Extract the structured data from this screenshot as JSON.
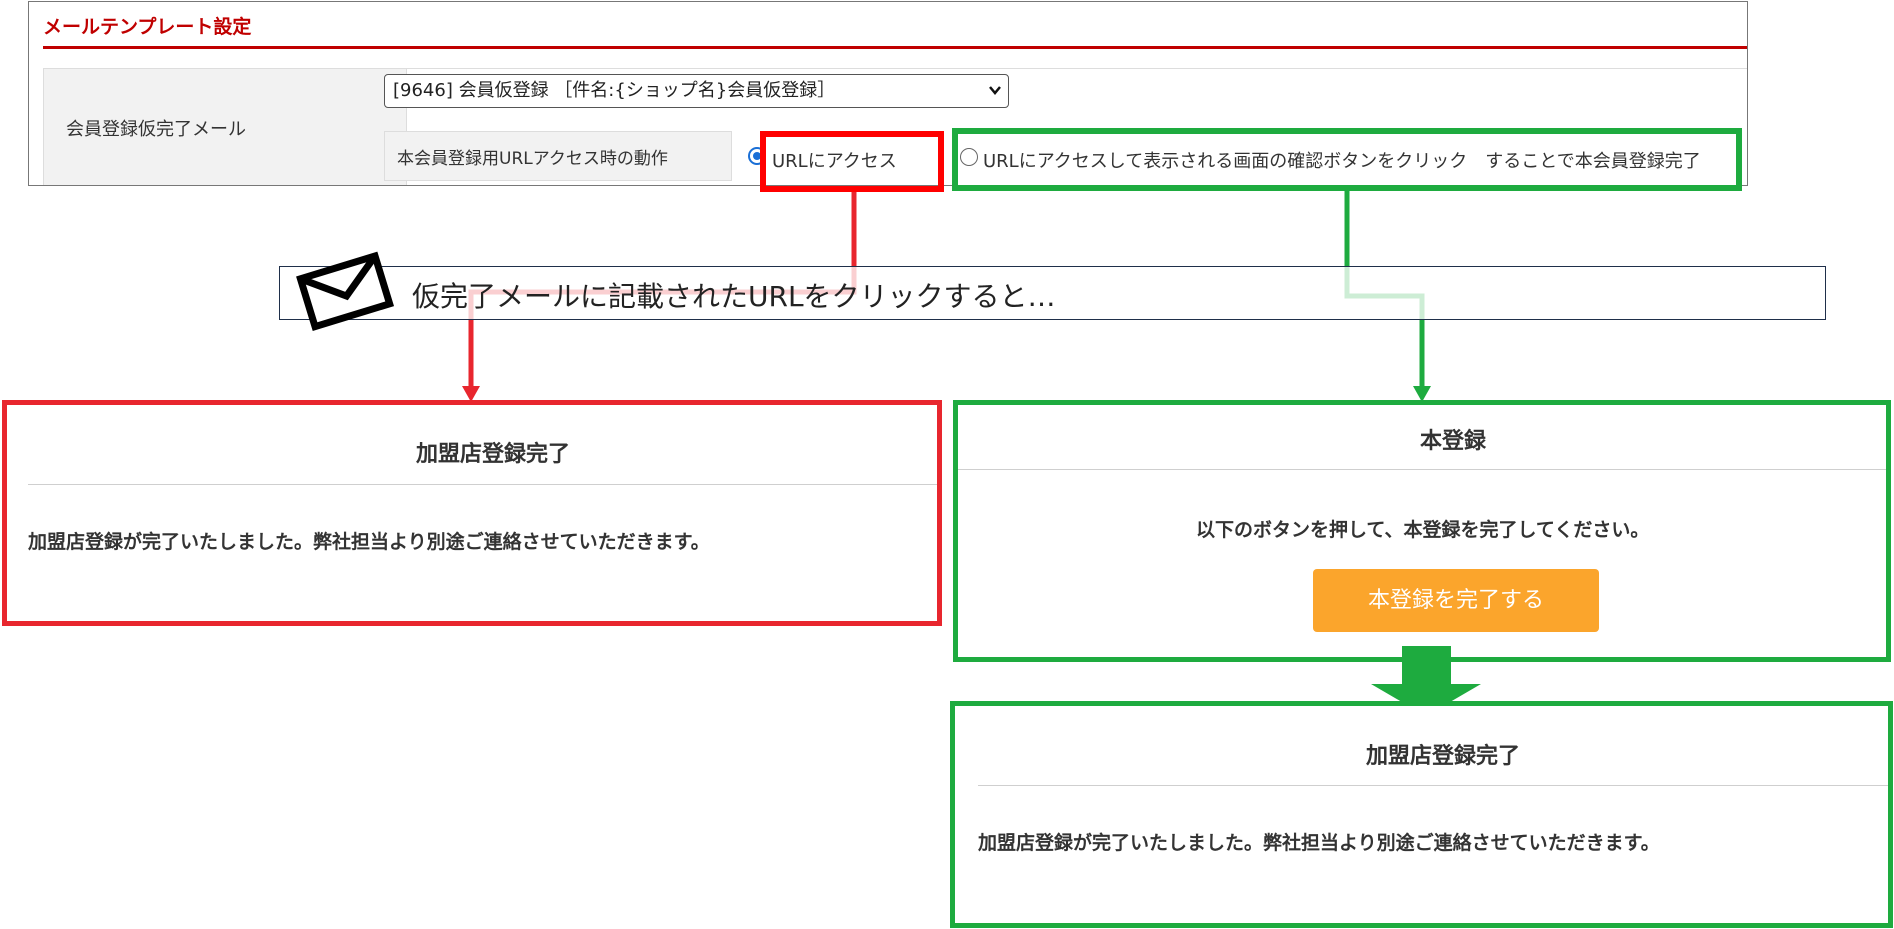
{
  "settings": {
    "title": "メールテンプレート設定",
    "row_label": "会員登録仮完了メール",
    "template_select": {
      "value": "[9646] 会員仮登録 ［件名:{ショップ名}会員仮登録］",
      "icon": "chevron-down-icon"
    },
    "action_label": "本会員登録用URLアクセス時の動作",
    "options": [
      {
        "label": "URLにアクセス",
        "selected": true
      },
      {
        "label": "URLにアクセスして表示される画面の確認ボタンをクリック　することで本会員登録完了",
        "selected": false
      }
    ]
  },
  "note": {
    "text": "仮完了メールに記載されたURLをクリックすると…",
    "icon": "envelope-icon"
  },
  "result_direct": {
    "title": "加盟店登録完了",
    "message": "加盟店登録が完了いたしました。弊社担当より別途ご連絡させていただきます。"
  },
  "result_confirm": {
    "title": "本登録",
    "message": "以下のボタンを押して、本登録を完了してください。",
    "button_label": "本登録を完了する"
  },
  "result_confirm_done": {
    "title": "加盟店登録完了",
    "message": "加盟店登録が完了いたしました。弊社担当より別途ご連絡させていただきます。"
  },
  "colors": {
    "heading_red": "#c00000",
    "highlight_red": "#ff0000",
    "highlight_green": "#1eab3f",
    "button_orange": "#fba52c",
    "radio_blue": "#1a6fd6"
  }
}
